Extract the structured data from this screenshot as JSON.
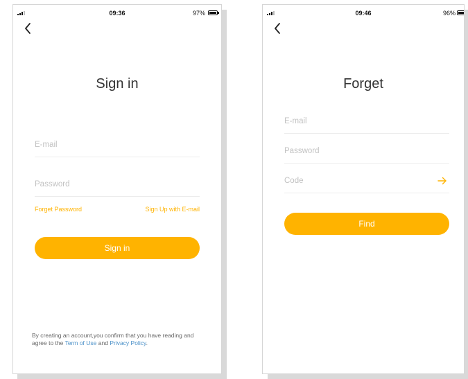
{
  "colors": {
    "accent": "#FFB300",
    "link_blue": "#4A90C8",
    "placeholder": "#C2C2C2"
  },
  "signin": {
    "status": {
      "time": "09:36",
      "battery": "97%",
      "battery_level": 0.97
    },
    "back_icon": "chevron-left-icon",
    "title": "Sign in",
    "email": {
      "placeholder": "E-mail",
      "value": ""
    },
    "password": {
      "placeholder": "Password",
      "value": ""
    },
    "forget_link": "Forget Password",
    "signup_link": "Sign Up with E-mail",
    "signin_button": "Sign in",
    "footer": {
      "line1": "By creating an account,you confirm that you have reading and",
      "prefix": "agree to the ",
      "terms": "Term of Use",
      "and": " and ",
      "privacy": "Privacy Policy",
      "suffix": "."
    }
  },
  "forget": {
    "status": {
      "time": "09:46",
      "battery": "96%",
      "battery_level": 0.96
    },
    "back_icon": "chevron-left-icon",
    "title": "Forget",
    "email": {
      "placeholder": "E-mail",
      "value": ""
    },
    "password": {
      "placeholder": "Password",
      "value": ""
    },
    "code": {
      "placeholder": "Code",
      "value": ""
    },
    "send_code_icon": "arrow-right-icon",
    "find_button": "Find"
  }
}
